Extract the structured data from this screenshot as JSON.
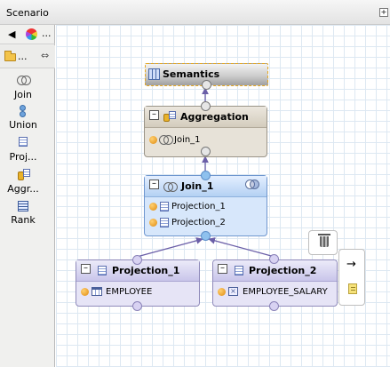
{
  "window": {
    "title": "Scenario"
  },
  "palette": {
    "toolbar": {
      "back_icon": "arrow-left-icon",
      "spectrum_icon": "color-spectrum-icon",
      "more": "..."
    },
    "drawer": {
      "label": "..."
    },
    "tools": [
      {
        "label": "Join",
        "icon": "join-icon"
      },
      {
        "label": "Union",
        "icon": "union-icon"
      },
      {
        "label": "Proj...",
        "icon": "projection-icon"
      },
      {
        "label": "Aggr...",
        "icon": "aggregation-icon"
      },
      {
        "label": "Rank",
        "icon": "rank-icon"
      }
    ]
  },
  "nodes": {
    "semantics": {
      "title": "Semantics"
    },
    "aggregation": {
      "title": "Aggregation",
      "inputs": [
        "Join_1"
      ]
    },
    "join": {
      "title": "Join_1",
      "inputs": [
        "Projection_1",
        "Projection_2"
      ]
    },
    "projection1": {
      "title": "Projection_1",
      "source": "EMPLOYEE"
    },
    "projection2": {
      "title": "Projection_2",
      "source": "EMPLOYEE_SALARY"
    }
  },
  "colors": {
    "join_fill": "#d7e7fb",
    "aggregation_fill": "#e7e2d8",
    "projection_fill": "#e6e4f6",
    "edge": "#6b5fa8",
    "grid": "#dde8f2"
  }
}
